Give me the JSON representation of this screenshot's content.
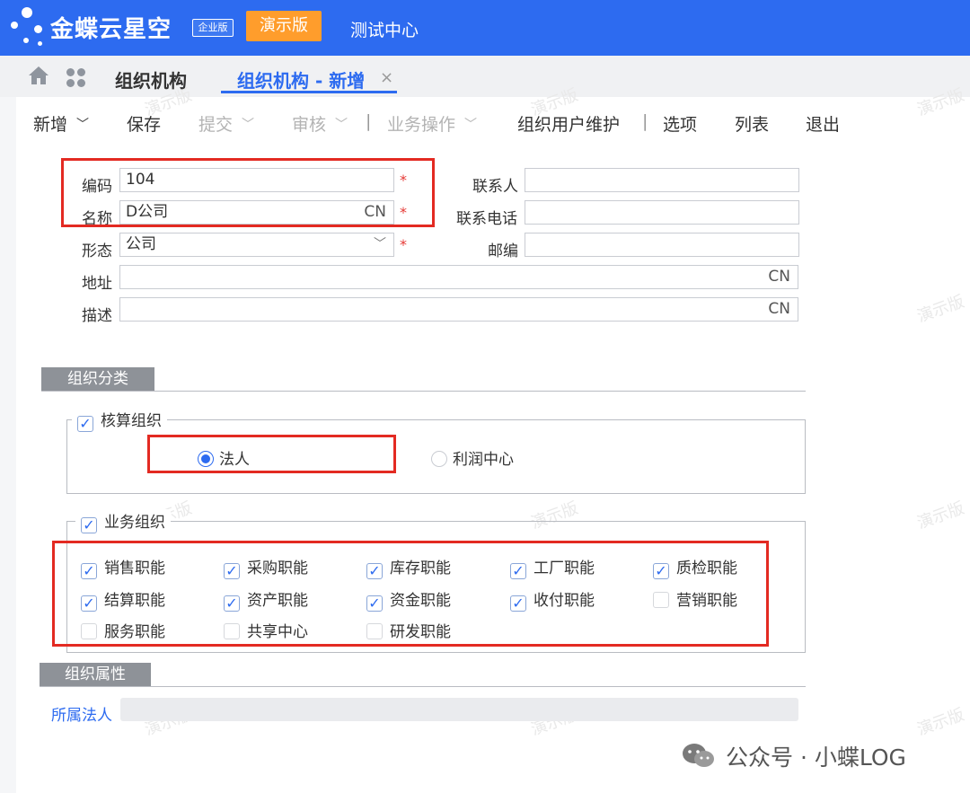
{
  "header": {
    "brand": "金蝶云星空",
    "edition_badge": "企业版",
    "demo_button": "演示版",
    "center_title": "测试中心"
  },
  "tabs": {
    "tab1": "组织机构",
    "tab2": "组织机构 - 新增",
    "close": "×"
  },
  "toolbar": {
    "new": "新增",
    "save": "保存",
    "submit": "提交",
    "audit": "审核",
    "business_ops": "业务操作",
    "org_user_maint": "组织用户维护",
    "options": "选项",
    "list": "列表",
    "exit": "退出",
    "sep": "|"
  },
  "form": {
    "code_label": "编码",
    "code_value": "104",
    "name_label": "名称",
    "name_value": "D公司",
    "lang_suffix": "CN",
    "form_label": "形态",
    "form_value": "公司",
    "address_label": "地址",
    "desc_label": "描述",
    "contact_label": "联系人",
    "phone_label": "联系电话",
    "zip_label": "邮编",
    "required_mark": "*"
  },
  "org_category": {
    "section_title": "组织分类",
    "accounting_group": "核算组织",
    "accounting_checked": true,
    "radio_legal": "法人",
    "radio_profit": "利润中心",
    "business_group": "业务组织",
    "business_checked": true,
    "functions": [
      {
        "label": "销售职能",
        "checked": true
      },
      {
        "label": "采购职能",
        "checked": true
      },
      {
        "label": "库存职能",
        "checked": true
      },
      {
        "label": "工厂职能",
        "checked": true
      },
      {
        "label": "质检职能",
        "checked": true
      },
      {
        "label": "结算职能",
        "checked": true
      },
      {
        "label": "资产职能",
        "checked": true
      },
      {
        "label": "资金职能",
        "checked": true
      },
      {
        "label": "收付职能",
        "checked": true
      },
      {
        "label": "营销职能",
        "checked": false
      },
      {
        "label": "服务职能",
        "checked": false
      },
      {
        "label": "共享中心",
        "checked": false
      },
      {
        "label": "研发职能",
        "checked": false
      }
    ]
  },
  "org_attributes": {
    "section_title": "组织属性",
    "legal_entity_label": "所属法人"
  },
  "watermark": "演示版",
  "footer": "公众号 · 小蝶LOG",
  "colors": {
    "primary": "#2d6bf0",
    "demo": "#ff9d2c",
    "highlight": "#e32a22"
  }
}
